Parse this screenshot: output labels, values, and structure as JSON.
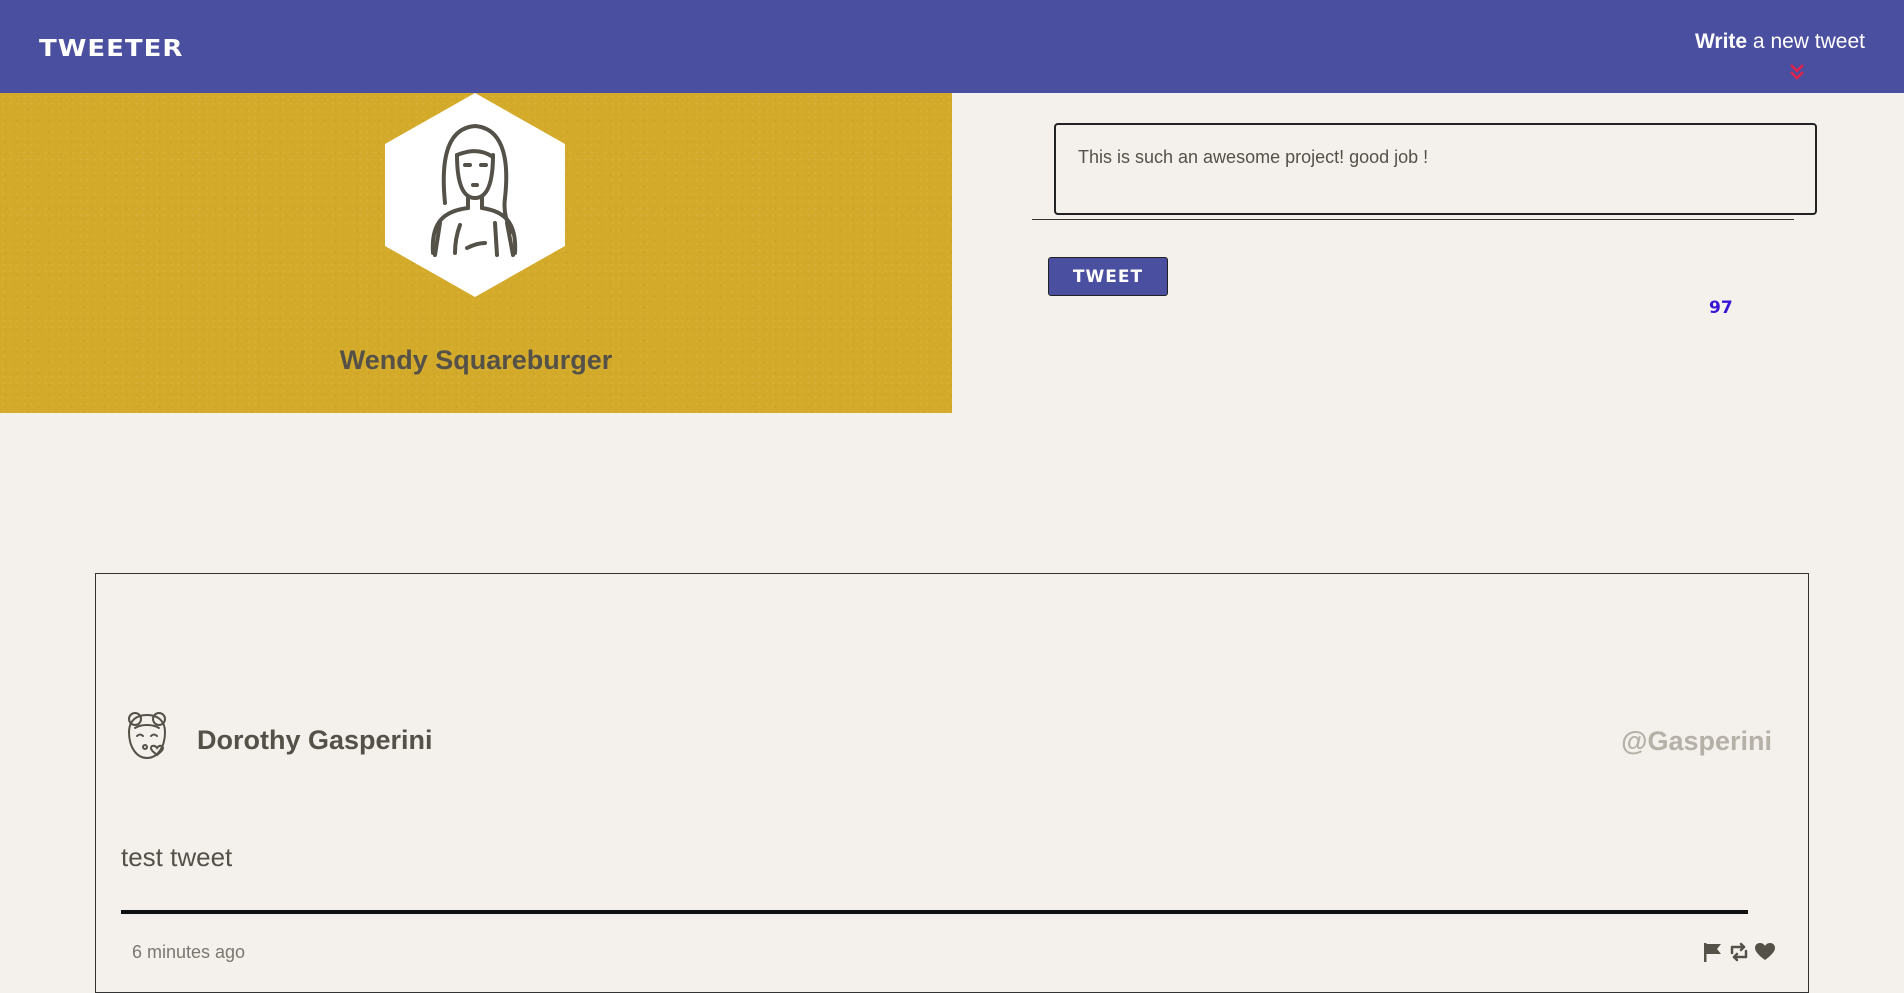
{
  "nav": {
    "brand": "TWEETER",
    "cta_bold": "Write",
    "cta_rest": " a new tweet",
    "cta_icon": "double-chevron-down-icon"
  },
  "profile": {
    "name": "Wendy Squareburger",
    "avatar_icon": "woman-avatar-icon"
  },
  "composer": {
    "value": "This is such an awesome project! good job !",
    "button_label": "TWEET",
    "char_count": "97"
  },
  "tweet": {
    "author": "Dorothy Gasperini",
    "handle": "@Gasperini",
    "text": "test tweet",
    "time": "6 minutes ago",
    "avatar_icon": "girl-avatar-icon",
    "actions": [
      "flag-icon",
      "retweet-icon",
      "heart-icon"
    ]
  },
  "colors": {
    "nav": "#4b4fa0",
    "profile_bg": "#d4aa2a",
    "page_bg": "#f4f1ec",
    "counter": "#3b15d6",
    "chevron": "#e0224a"
  }
}
